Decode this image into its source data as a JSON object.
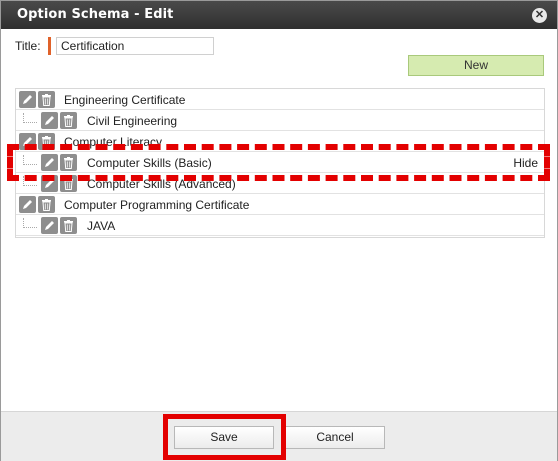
{
  "window": {
    "title": "Option Schema - Edit",
    "close_glyph": "✕"
  },
  "form": {
    "title_label": "Title:",
    "title_value": "Certification"
  },
  "toolbar": {
    "new_label": "New"
  },
  "tree": {
    "rows": [
      {
        "label": "Engineering Certificate"
      },
      {
        "label": "Civil Engineering"
      },
      {
        "label": "Computer Literacy"
      },
      {
        "label": "Computer Skills (Basic)",
        "action": "Hide"
      },
      {
        "label": "Computer Skills (Advanced)"
      },
      {
        "label": "Computer Programming Certificate"
      },
      {
        "label": "JAVA"
      }
    ]
  },
  "footer": {
    "save_label": "Save",
    "cancel_label": "Cancel"
  },
  "icons": {
    "edit": "pencil-icon",
    "delete": "trash-icon"
  },
  "colors": {
    "annotation_red": "#e30000",
    "new_button": "#d6ebb0",
    "title_bar": "#3a3a3a",
    "required_mark": "#e0622a"
  }
}
